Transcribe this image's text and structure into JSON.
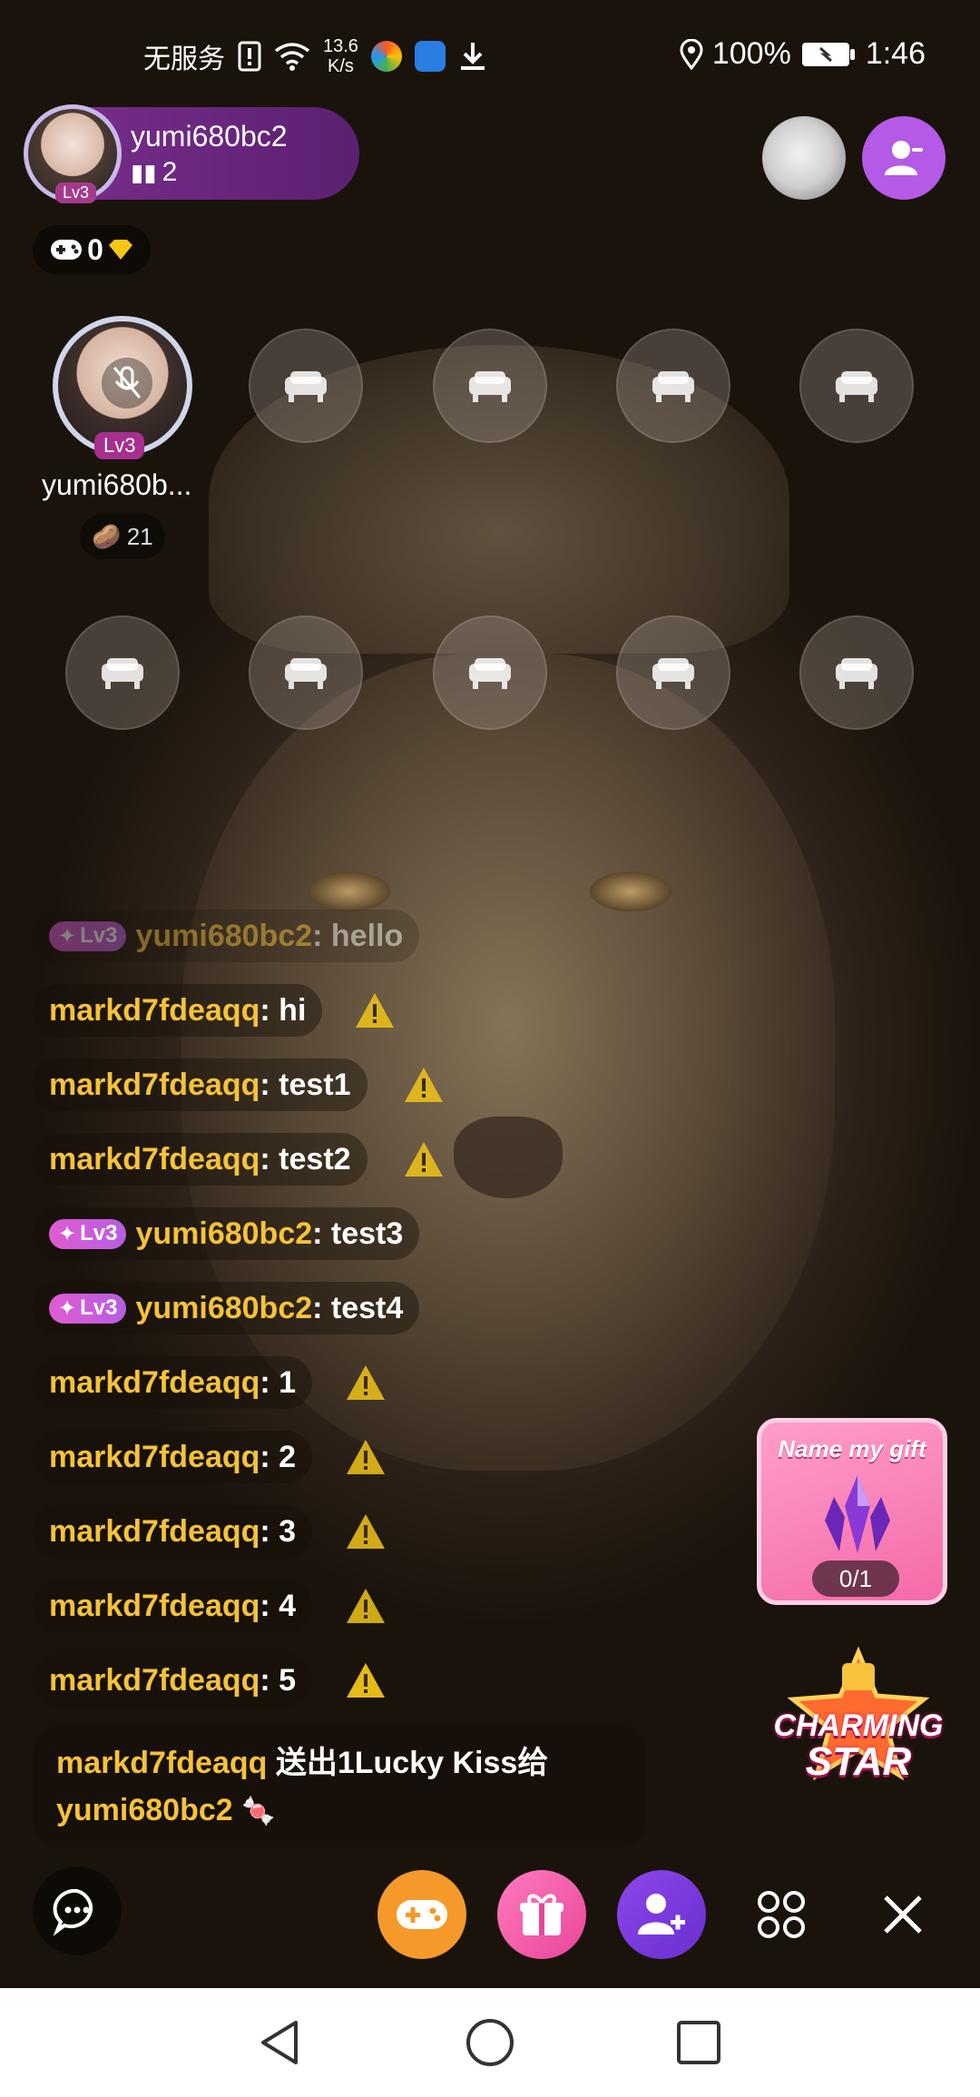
{
  "status_bar": {
    "carrier": "无服务",
    "net_speed_value": "13.6",
    "net_speed_unit": "K/s",
    "battery": "100%",
    "time": "1:46"
  },
  "host": {
    "name": "yumi680bc2",
    "level": "Lv3",
    "listeners": "2"
  },
  "diamonds": {
    "count": "0"
  },
  "seats": {
    "occupied": {
      "name": "yumi680b...",
      "level": "Lv3",
      "gifts": "21"
    }
  },
  "chat": [
    {
      "user": "yumi680bc2",
      "badge": "Lv3",
      "text": ": hello"
    },
    {
      "user": "markd7fdeaqq",
      "text": ": hi"
    },
    {
      "user": "markd7fdeaqq",
      "text": ": test1"
    },
    {
      "user": "markd7fdeaqq",
      "text": ": test2"
    },
    {
      "user": "yumi680bc2",
      "badge": "Lv3",
      "text": ": test3"
    },
    {
      "user": "yumi680bc2",
      "badge": "Lv3",
      "text": ": test4"
    },
    {
      "user": "markd7fdeaqq",
      "text": ": 1"
    },
    {
      "user": "markd7fdeaqq",
      "text": ": 2"
    },
    {
      "user": "markd7fdeaqq",
      "text": ": 3"
    },
    {
      "user": "markd7fdeaqq",
      "text": ": 4"
    },
    {
      "user": "markd7fdeaqq",
      "text": ": 5"
    }
  ],
  "gift_message": {
    "sender": "markd7fdeaqq",
    "action": "送出1Lucky Kiss给",
    "receiver": "yumi680bc2"
  },
  "name_my_gift": {
    "title": "Name my gift",
    "progress": "0/1"
  },
  "charming_star": {
    "line1": "CHARMING",
    "line2": "STAR"
  },
  "colors": {
    "username": "#f5c23a",
    "accent_purple": "#b45ae6",
    "warning": "#f0c419"
  }
}
